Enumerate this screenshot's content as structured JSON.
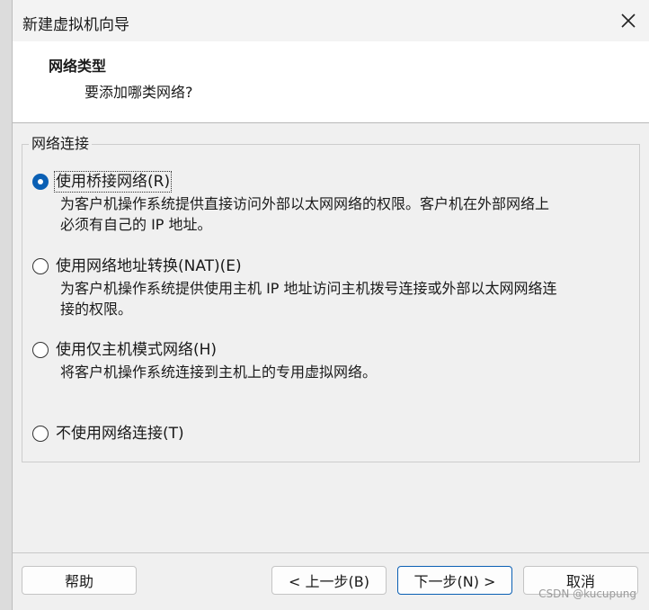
{
  "window": {
    "title": "新建虚拟机向导"
  },
  "header": {
    "title": "网络类型",
    "subtitle": "要添加哪类网络?"
  },
  "group": {
    "legend": "网络连接"
  },
  "options": [
    {
      "label": "使用桥接网络(R)",
      "checked": true,
      "description_lines": [
        "为客户机操作系统提供直接访问外部以太网网络的权限。客户机在外部网络上",
        "必须有自己的 IP 地址。"
      ]
    },
    {
      "label": "使用网络地址转换(NAT)(E)",
      "checked": false,
      "description_lines": [
        "为客户机操作系统提供使用主机 IP 地址访问主机拨号连接或外部以太网网络连",
        "接的权限。"
      ]
    },
    {
      "label": "使用仅主机模式网络(H)",
      "checked": false,
      "description_lines": [
        "将客户机操作系统连接到主机上的专用虚拟网络。"
      ]
    },
    {
      "label": "不使用网络连接(T)",
      "checked": false,
      "description_lines": []
    }
  ],
  "buttons": {
    "help": "帮助",
    "back": "< 上一步(B)",
    "next": "下一步(N) >",
    "cancel": "取消"
  },
  "watermark": "CSDN @kucupung",
  "colors": {
    "accent": "#0a5fb4",
    "background": "#f0f0f0",
    "header_bg": "#ffffff"
  }
}
